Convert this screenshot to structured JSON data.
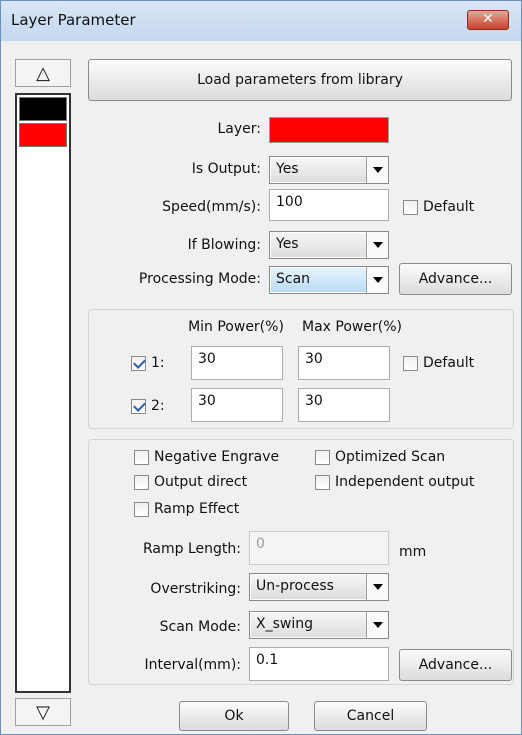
{
  "window": {
    "title": "Layer Parameter",
    "close_glyph": "✕"
  },
  "layer_list": {
    "up_glyph": "△",
    "down_glyph": "▽",
    "swatches": [
      "#000000",
      "#ff0000"
    ]
  },
  "top": {
    "load_button": "Load parameters from library",
    "layer_label": "Layer:",
    "layer_color": "#ff0000",
    "is_output_label": "Is Output:",
    "is_output_value": "Yes",
    "speed_label": "Speed(mm/s):",
    "speed_value": "100",
    "speed_default": "Default",
    "if_blowing_label": "If Blowing:",
    "if_blowing_value": "Yes",
    "processing_mode_label": "Processing Mode:",
    "processing_mode_value": "Scan",
    "advance_button": "Advance..."
  },
  "power": {
    "min_header": "Min Power(%)",
    "max_header": "Max Power(%)",
    "row1_label": "1:",
    "row1_min": "30",
    "row1_max": "30",
    "row2_label": "2:",
    "row2_min": "30",
    "row2_max": "30",
    "default_label": "Default"
  },
  "scan": {
    "negative_engrave": "Negative Engrave",
    "optimized_scan": "Optimized Scan",
    "output_direct": "Output direct",
    "independent_output": "Independent output",
    "ramp_effect": "Ramp Effect",
    "ramp_length_label": "Ramp Length:",
    "ramp_length_value": "0",
    "ramp_unit": "mm",
    "overstriking_label": "Overstriking:",
    "overstriking_value": "Un-process",
    "scan_mode_label": "Scan Mode:",
    "scan_mode_value": "X_swing",
    "interval_label": "Interval(mm):",
    "interval_value": "0.1",
    "advance_button": "Advance..."
  },
  "footer": {
    "ok": "Ok",
    "cancel": "Cancel"
  }
}
